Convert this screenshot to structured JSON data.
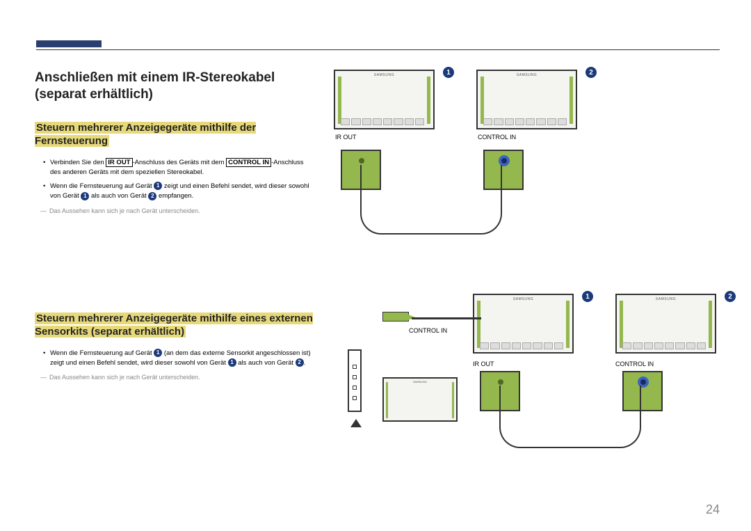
{
  "title": "Anschließen mit einem IR-Stereokabel (separat erhältlich)",
  "section1": {
    "heading": "Steuern mehrerer Anzeigegeräte mithilfe der Fernsteuerung",
    "bullet1_a": "Verbinden Sie den ",
    "bullet1_b": "IR OUT",
    "bullet1_c": "-Anschluss des Geräts mit dem ",
    "bullet1_d": "CONTROL IN",
    "bullet1_e": "-Anschluss des anderen Geräts mit dem speziellen Stereokabel.",
    "bullet2_a": "Wenn die Fernsteuerung auf Gerät ",
    "bullet2_b": " zeigt und einen Befehl sendet, wird dieser sowohl von Gerät ",
    "bullet2_c": " als auch von Gerät ",
    "bullet2_d": " empfangen.",
    "note": "Das Aussehen kann sich je nach Gerät unterscheiden."
  },
  "section2": {
    "heading": "Steuern mehrerer Anzeigegeräte mithilfe eines externen Sensorkits (separat erhältlich)",
    "bullet1_a": "Wenn die Fernsteuerung auf Gerät ",
    "bullet1_b": " (an dem das externe Sensorkit angeschlossen ist) zeigt und einen Befehl sendet, wird dieser sowohl von Gerät ",
    "bullet1_c": " als auch von Gerät ",
    "bullet1_d": ".",
    "note": "Das Aussehen kann sich je nach Gerät unterscheiden."
  },
  "labels": {
    "ir_out": "IR OUT",
    "control_in": "CONTROL IN"
  },
  "nums": {
    "n1": "1",
    "n2": "2"
  },
  "pageno": "24"
}
